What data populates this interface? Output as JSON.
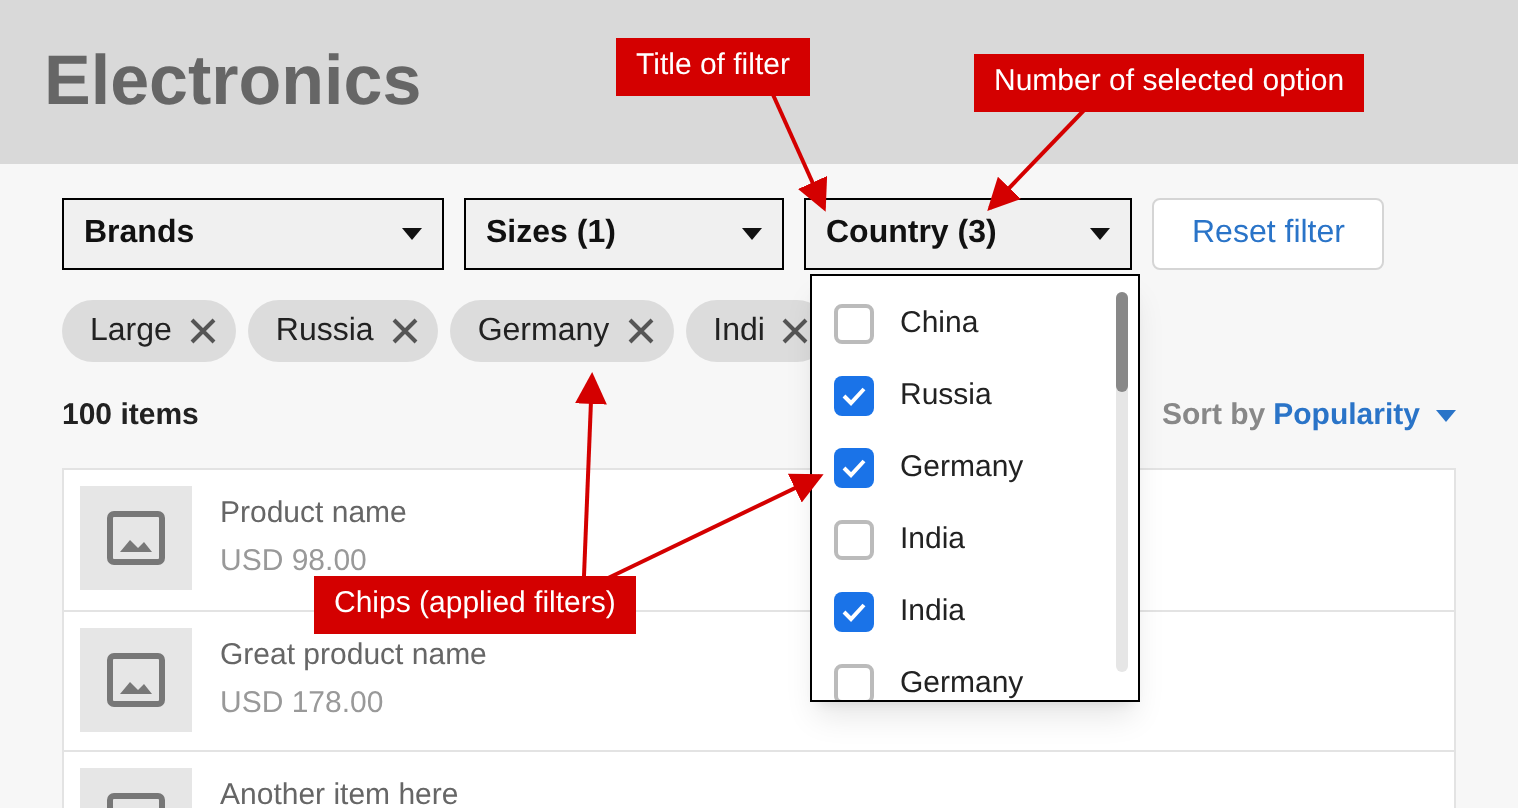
{
  "page": {
    "title": "Electronics"
  },
  "filters": [
    {
      "label": "Brands"
    },
    {
      "label": "Sizes (1)"
    },
    {
      "label": "Country (3)",
      "options": [
        {
          "label": "China",
          "checked": false
        },
        {
          "label": "Russia",
          "checked": true
        },
        {
          "label": "Germany",
          "checked": true
        },
        {
          "label": "India",
          "checked": false
        },
        {
          "label": "India",
          "checked": true
        },
        {
          "label": "Germany",
          "checked": false
        }
      ]
    }
  ],
  "reset_button": "Reset filter",
  "chips": [
    "Large",
    "Russia",
    "Germany",
    "Indi"
  ],
  "count": "100 items",
  "sort": {
    "label": "Sort by",
    "value": "Popularity"
  },
  "products": [
    {
      "name": "Product name",
      "price": "USD 98.00"
    },
    {
      "name": "Great product name",
      "price": "USD 178.00"
    },
    {
      "name": "Another item here"
    }
  ],
  "annotations": [
    {
      "text": "Title of filter"
    },
    {
      "text": "Number of selected option"
    },
    {
      "text": "Chips (applied filters)"
    }
  ]
}
